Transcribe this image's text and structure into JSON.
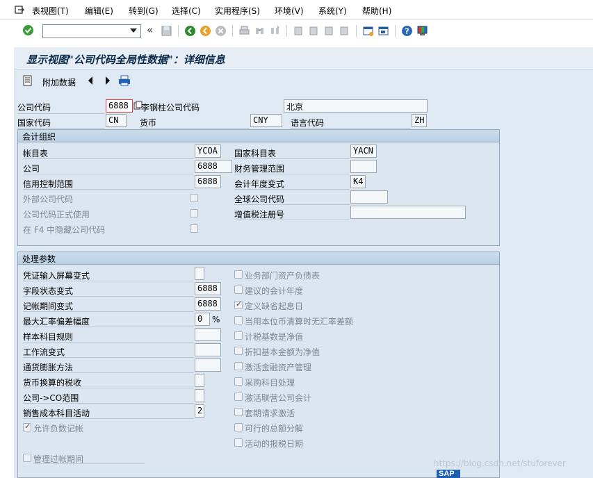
{
  "menu": [
    "表视图(T)",
    "编辑(E)",
    "转到(G)",
    "选择(C)",
    "实用程序(S)",
    "环境(V)",
    "系统(Y)",
    "帮助(H)"
  ],
  "toolbar": {
    "command_value": ""
  },
  "title": "显示视图\"公司代码全局性数据\"：详细信息",
  "app_toolbar": {
    "additional_data": "附加数据"
  },
  "header": {
    "company_code_label": "公司代码",
    "company_code_value": "6888",
    "company_name": "李钢柱公司代码",
    "city": "北京",
    "country_label": "国家代码",
    "country_value": "CN",
    "currency_label": "货币",
    "currency_value": "CNY",
    "language_label": "语言代码",
    "language_value": "ZH"
  },
  "accounting": {
    "title": "会计组织",
    "chart_of_accounts_label": "帐目表",
    "chart_of_accounts_value": "YCOA",
    "country_coa_label": "国家科目表",
    "country_coa_value": "YACN",
    "company_label": "公司",
    "company_value": "6888",
    "fm_area_label": "财务管理范围",
    "fm_area_value": "",
    "credit_area_label": "信用控制范围",
    "credit_area_value": "6888",
    "fiscal_year_variant_label": "会计年度变式",
    "fiscal_year_variant_value": "K4",
    "external_company_label": "外部公司代码",
    "global_company_label": "全球公司代码",
    "global_company_value": "",
    "productive_label": "公司代码正式使用",
    "vat_label": "增值税注册号",
    "vat_value": "",
    "hide_f4_label": "在 F4 中隐藏公司代码"
  },
  "processing": {
    "title": "处理参数",
    "doc_entry_label": "凭证输入屏幕变式",
    "doc_entry_value": "",
    "field_status_label": "字段状态变式",
    "field_status_value": "6888",
    "posting_period_label": "记帐期间变式",
    "posting_period_value": "6888",
    "max_fx_label": "最大汇率偏差幅度",
    "max_fx_value": "0",
    "max_fx_unit": "%",
    "sample_rules_label": "样本科目规则",
    "sample_rules_value": "",
    "workflow_label": "工作流变式",
    "workflow_value": "",
    "inflation_label": "通货膨胀方法",
    "inflation_value": "",
    "tax_currency_label": "货币换算的税收",
    "tax_currency_value": "",
    "co_area_label": "公司->CO范围",
    "co_area_value": "",
    "cogs_label": "销售成本科目活动",
    "cogs_value": "2",
    "negative_postings_label": "允许负数记帐",
    "manage_periods_label": "管理过帐期间",
    "right_options": [
      {
        "label": "业务部门资产负债表",
        "checked": false
      },
      {
        "label": "建议的会计年度",
        "checked": false
      },
      {
        "label": "定义缺省起息日",
        "checked": true
      },
      {
        "label": "当用本位币清算时无汇率差额",
        "checked": false
      },
      {
        "label": "计税基数是净值",
        "checked": false
      },
      {
        "label": "折扣基本金额为净值",
        "checked": false
      },
      {
        "label": "激活金融资产管理",
        "checked": false
      },
      {
        "label": "采购科目处理",
        "checked": false
      },
      {
        "label": "激活联营公司会计",
        "checked": false
      },
      {
        "label": "套期请求激活",
        "checked": false
      },
      {
        "label": "可行的总额分解",
        "checked": false
      },
      {
        "label": "活动的报税日期",
        "checked": false
      }
    ]
  },
  "watermark": "https://blog.csdn.net/stuforever",
  "brand_logo": "SAP",
  "colors": {
    "sap_blue": "#1f5faf",
    "accent_green": "#2e8b2e",
    "accent_orange": "#e8a028"
  }
}
